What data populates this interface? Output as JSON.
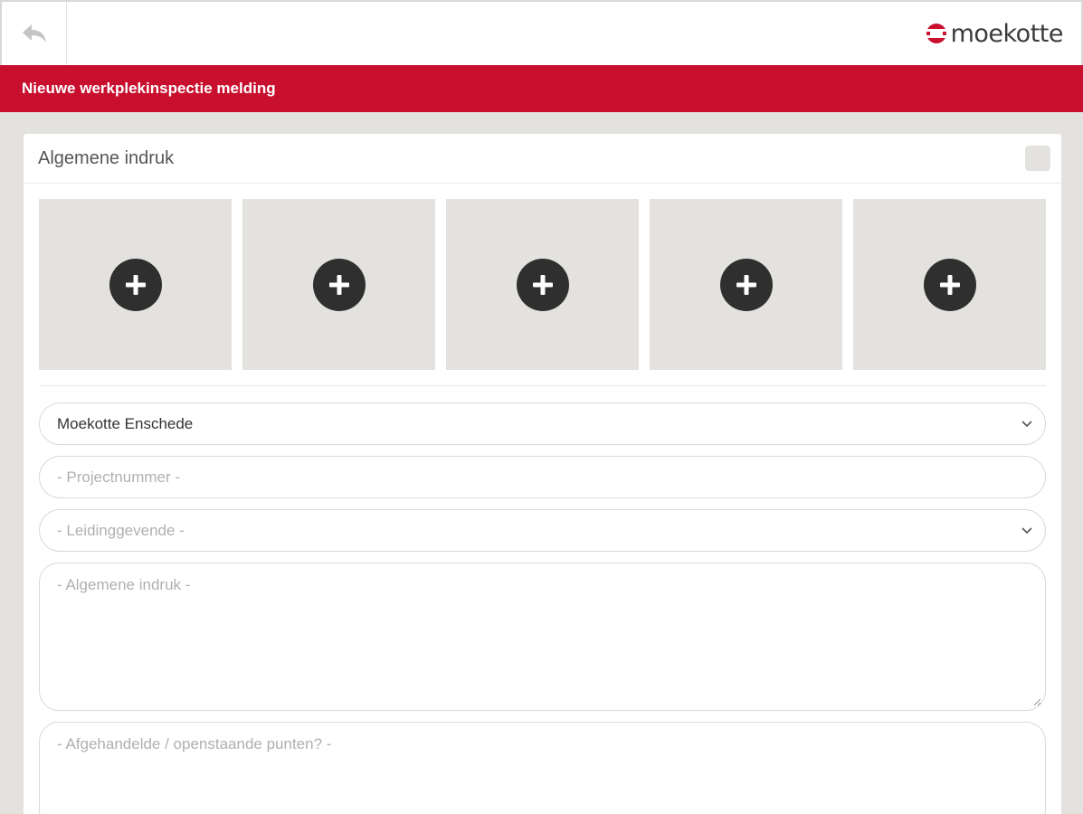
{
  "header": {
    "back_icon": "back-arrow-icon",
    "logo_text": "moekotte",
    "brand_color": "#c8102e"
  },
  "titlebar": {
    "title": "Nieuwe werkplekinspectie melding"
  },
  "card": {
    "title": "Algemene indruk",
    "photo_slots": [
      {
        "icon": "add-photo-icon"
      },
      {
        "icon": "add-photo-icon"
      },
      {
        "icon": "add-photo-icon"
      },
      {
        "icon": "add-photo-icon"
      },
      {
        "icon": "add-photo-icon"
      }
    ]
  },
  "form": {
    "location_value": "Moekotte Enschede",
    "project_placeholder": "- Projectnummer -",
    "manager_placeholder": "- Leidinggevende -",
    "impression_placeholder": "- Algemene indruk -",
    "points_placeholder": "- Afgehandelde / openstaande punten? -"
  }
}
